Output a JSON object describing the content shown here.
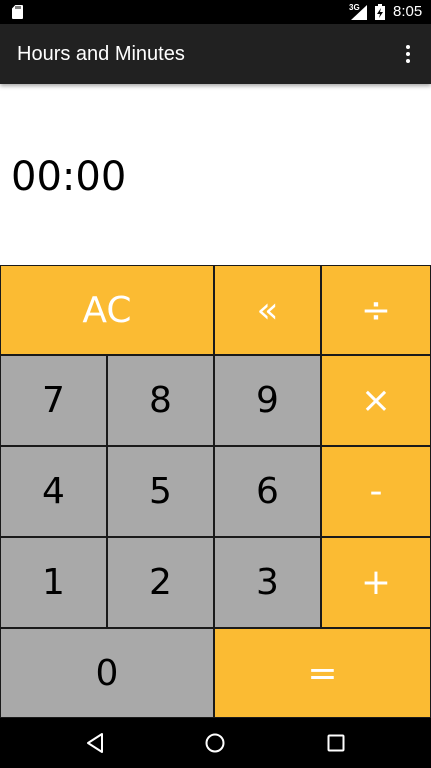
{
  "status_bar": {
    "network_label": "3G",
    "time": "8:05",
    "icons": [
      "sd-card-icon",
      "signal-icon",
      "battery-charging-icon"
    ]
  },
  "toolbar": {
    "title": "Hours and Minutes",
    "overflow_icon": "more-vert-icon"
  },
  "display": {
    "value": "00:00"
  },
  "keypad": {
    "ac": "AC",
    "backspace": "«",
    "divide": "÷",
    "seven": "7",
    "eight": "8",
    "nine": "9",
    "multiply": "×",
    "four": "4",
    "five": "5",
    "six": "6",
    "minus": "-",
    "one": "1",
    "two": "2",
    "three": "3",
    "plus": "+",
    "zero": "0",
    "equals": "="
  },
  "colors": {
    "operator_key": "#fbbb33",
    "number_key": "#a9a9a9",
    "toolbar": "#212121"
  },
  "nav_bar": {
    "icons": [
      "back-icon",
      "home-icon",
      "recents-icon"
    ]
  }
}
